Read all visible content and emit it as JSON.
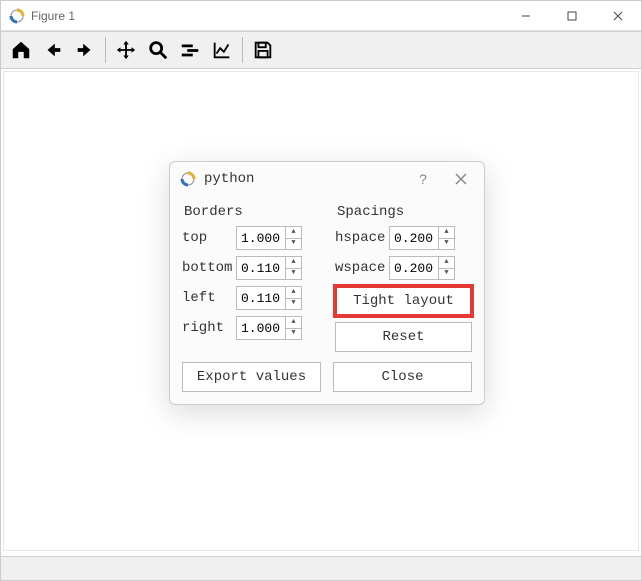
{
  "window": {
    "title": "Figure 1"
  },
  "dialog": {
    "title": "python",
    "borders_label": "Borders",
    "spacings_label": "Spacings",
    "borders": {
      "top": {
        "label": "top",
        "value": "1.000"
      },
      "bottom": {
        "label": "bottom",
        "value": "0.110"
      },
      "left": {
        "label": "left",
        "value": "0.110"
      },
      "right": {
        "label": "right",
        "value": "1.000"
      }
    },
    "spacings": {
      "hspace": {
        "label": "hspace",
        "value": "0.200"
      },
      "wspace": {
        "label": "wspace",
        "value": "0.200"
      }
    },
    "buttons": {
      "tight_layout": "Tight layout",
      "reset": "Reset",
      "export_values": "Export values",
      "close": "Close"
    },
    "help": "?"
  }
}
